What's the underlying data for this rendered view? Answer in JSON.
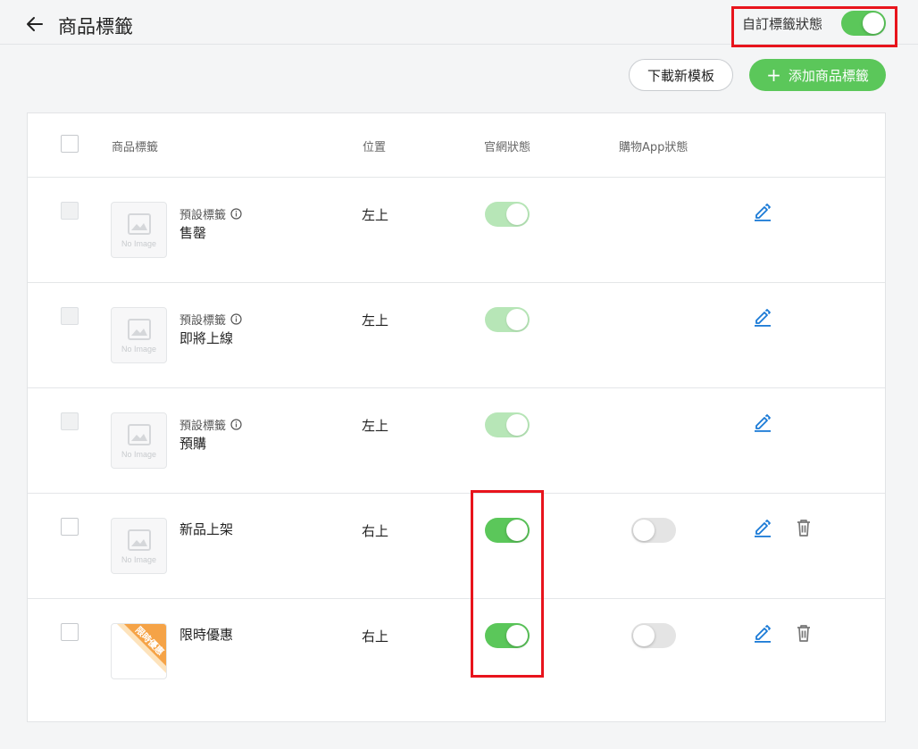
{
  "header": {
    "title": "商品標籤",
    "back_icon": "arrow-left-icon",
    "custom_status_label": "自訂標籤狀態",
    "custom_status_on": true
  },
  "toolbar": {
    "download_label": "下載新模板",
    "add_label": "添加商品標籤",
    "add_icon": "+"
  },
  "table": {
    "columns": {
      "tag": "商品標籤",
      "position": "位置",
      "web_status": "官網狀態",
      "app_status": "購物App狀態"
    },
    "no_image_text": "No Image",
    "rows": [
      {
        "default_label": "預設標籤",
        "name": "售罄",
        "position": "左上",
        "web_on": true,
        "app_on": null
      },
      {
        "default_label": "預設標籤",
        "name": "即將上線",
        "position": "左上",
        "web_on": true,
        "app_on": null
      },
      {
        "default_label": "預設標籤",
        "name": "預購",
        "position": "左上",
        "web_on": true,
        "app_on": null
      },
      {
        "name": "新品上架",
        "position": "右上",
        "web_on": true,
        "app_on": false
      },
      {
        "name": "限時優惠",
        "position": "右上",
        "web_on": true,
        "app_on": false,
        "badge_text": "限時優惠"
      }
    ]
  },
  "colors": {
    "accent_green": "#5bc75a",
    "highlight_red": "#e8141c",
    "edit_blue": "#1a7ad6",
    "badge_orange": "#f5a347"
  }
}
